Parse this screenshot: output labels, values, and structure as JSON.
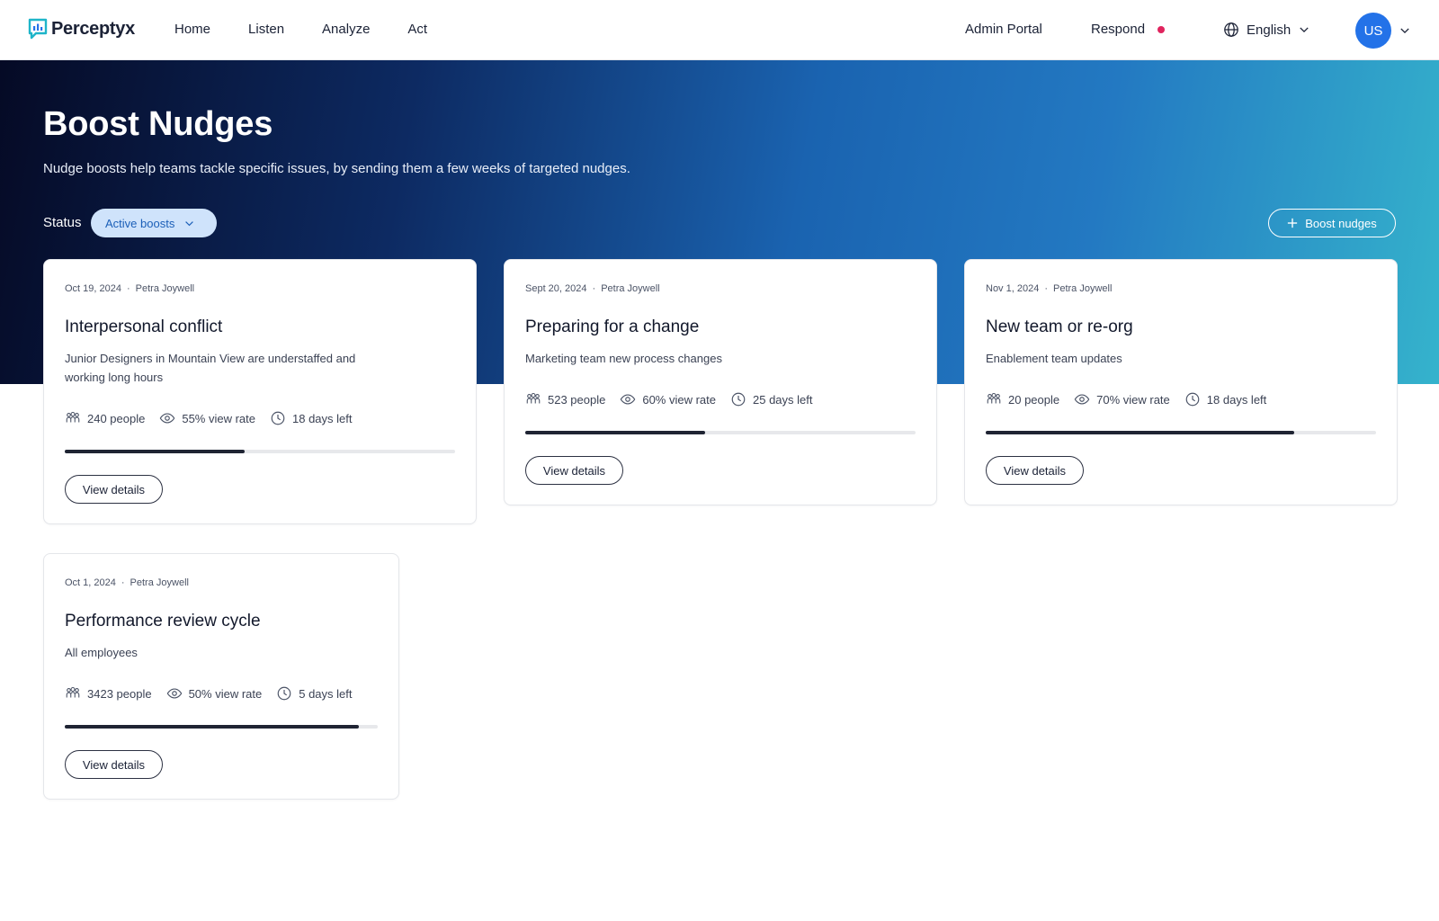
{
  "app": {
    "brand": "Perceptyx",
    "nav": [
      {
        "label": "Home"
      },
      {
        "label": "Listen"
      },
      {
        "label": "Analyze"
      },
      {
        "label": "Act"
      }
    ],
    "admin_label": "Admin Portal",
    "respond_label": "Respond",
    "language": "English",
    "user_initials": "US"
  },
  "hero": {
    "title": "Boost Nudges",
    "subtitle": "Nudge boosts help teams tackle specific issues, by sending them a few weeks of targeted nudges.",
    "status_label": "Status",
    "status_value": "Active boosts",
    "boost_button": "Boost nudges"
  },
  "cards": [
    {
      "date": "Oct 19, 2024",
      "author": "Petra Joywell",
      "title": "Interpersonal conflict",
      "description": "Junior Designers in Mountain View are understaffed and working long hours",
      "people": "240 people",
      "view_rate": "55% view rate",
      "days_left": "18 days left",
      "progress": 0.46,
      "button": "View details"
    },
    {
      "date": "Sept 20, 2024",
      "author": "Petra Joywell",
      "title": "Preparing for a change",
      "description": "Marketing team new process changes",
      "people": "523 people",
      "view_rate": "60% view rate",
      "days_left": "25 days left",
      "progress": 0.46,
      "button": "View details"
    },
    {
      "date": "Nov 1, 2024",
      "author": "Petra Joywell",
      "title": "New team or re-org",
      "description": "Enablement team updates",
      "people": "20 people",
      "view_rate": "70% view rate",
      "days_left": "18 days left",
      "progress": 0.79,
      "button": "View details"
    },
    {
      "date": "Oct 1, 2024",
      "author": "Petra Joywell",
      "title": "Performance review cycle",
      "description": "All employees",
      "people": "3423 people",
      "view_rate": "50% view rate",
      "days_left": "5 days left",
      "progress": 0.94,
      "button": "View details"
    }
  ],
  "colors": {
    "accent": "#2372e8",
    "notification": "#e0245e",
    "progress_fill": "#1f2433",
    "status_pill": "#cfe3fb"
  }
}
